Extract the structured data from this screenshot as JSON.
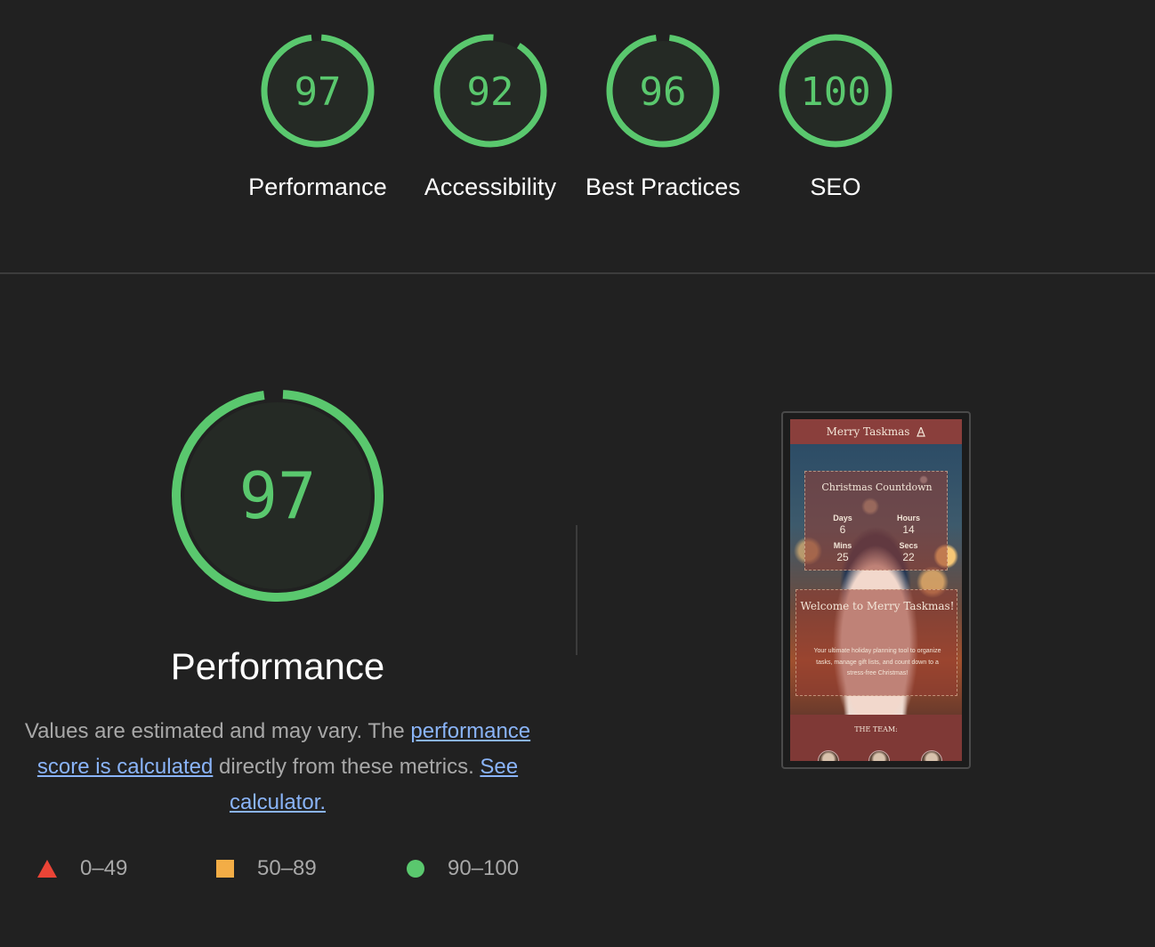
{
  "gauges": [
    {
      "id": "performance",
      "score": 97,
      "label": "Performance"
    },
    {
      "id": "accessibility",
      "score": 92,
      "label": "Accessibility"
    },
    {
      "id": "best-practices",
      "score": 96,
      "label": "Best Practices"
    },
    {
      "id": "seo",
      "score": 100,
      "label": "SEO"
    }
  ],
  "performance": {
    "score": 97,
    "title": "Performance",
    "description": {
      "text_before": "Values are estimated and may vary. The ",
      "link1": "performance score is calculated",
      "text_middle": " directly from these metrics. ",
      "link2": "See calculator."
    }
  },
  "legend": [
    {
      "shape": "triangle",
      "label": "0–49",
      "color": "#eb4436"
    },
    {
      "shape": "square",
      "label": "50–89",
      "color": "#f3ad46"
    },
    {
      "shape": "circle",
      "label": "90–100",
      "color": "#5ac86e"
    }
  ],
  "colors": {
    "pass": "#5ac86e",
    "gauge_fill": "#252a25",
    "background": "#212121",
    "link": "#8ab4f8"
  },
  "screenshot": {
    "header": "Merry Taskmas",
    "header_icon": "tree-icon",
    "countdown_title": "Christmas Countdown",
    "countdown": [
      {
        "label": "Days",
        "value": "6"
      },
      {
        "label": "Hours",
        "value": "14"
      },
      {
        "label": "Mins",
        "value": "25"
      },
      {
        "label": "Secs",
        "value": "22"
      }
    ],
    "welcome_title": "Welcome to Merry Taskmas!",
    "welcome_text": "Your ultimate holiday planning tool to organize tasks, manage gift lists, and count down to a stress-free Christmas!",
    "team_label": "THE TEAM:"
  }
}
